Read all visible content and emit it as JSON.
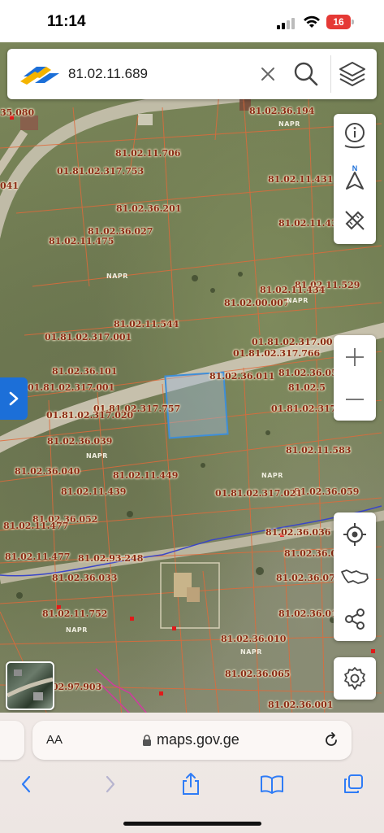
{
  "status": {
    "time": "11:14",
    "battery": "16"
  },
  "search": {
    "query": "81.02.11.689"
  },
  "map": {
    "parcels": [
      "35.080",
      "81.02.36.194",
      "01.81.02.317.753",
      "81.02.11.706",
      "041",
      "81.02.36.201",
      "81.02.11.431",
      "81.02.36.027",
      "81.02.11.475",
      "81.02.11.43",
      "81.02.11.529",
      "81.02.11.434",
      "81.02.00.007",
      "01.81.02.317.001",
      "81.02.11.544",
      "01.81.02.317.001",
      "01.81.02.317.766",
      "81.02.36.101",
      "81.02.36.011",
      "81.02.36.05",
      "01.81.02.317.001",
      "01.81.02.317.757",
      "81.02.5",
      "01.81.02.317",
      "01.81.02.317.020",
      "81.02.36.039",
      "81.02.11.583",
      "81.02.36.040",
      "81.02.11.449",
      "81.02.36.059",
      "81.02.11.439",
      "01.81.02.317.021",
      "81.02.36.052",
      "81.02.11.477",
      "81.02.36.036",
      "81.02.11.477",
      "81.02.93.248",
      "81.02.36.07",
      "81.02.36.033",
      "81.02.36.07",
      "81.02.11.752",
      "81.02.36.01",
      "81.02.36.010",
      "81.02.36.065",
      "02.97.903",
      "81.02.36.001"
    ],
    "watermark": "NAPR"
  },
  "tools": {
    "info_icon": "info-pin-icon",
    "compass_icon": "compass-north-icon",
    "compass_letter": "N",
    "measure_icon": "ruler-pencil-icon",
    "zoom_in_icon": "plus-icon",
    "zoom_out_icon": "minus-icon",
    "locate_icon": "crosshair-icon",
    "country_icon": "georgia-map-icon",
    "share_icon": "share-icon",
    "settings_icon": "gear-icon"
  },
  "browser": {
    "aa_label": "AA",
    "url": "maps.gov.ge"
  },
  "colors": {
    "parcel_line": "#e06a3a",
    "parcel_text": "#8a2a14",
    "accent_blue": "#1c6fd8",
    "selected_parcel": "#9fb7d6"
  }
}
